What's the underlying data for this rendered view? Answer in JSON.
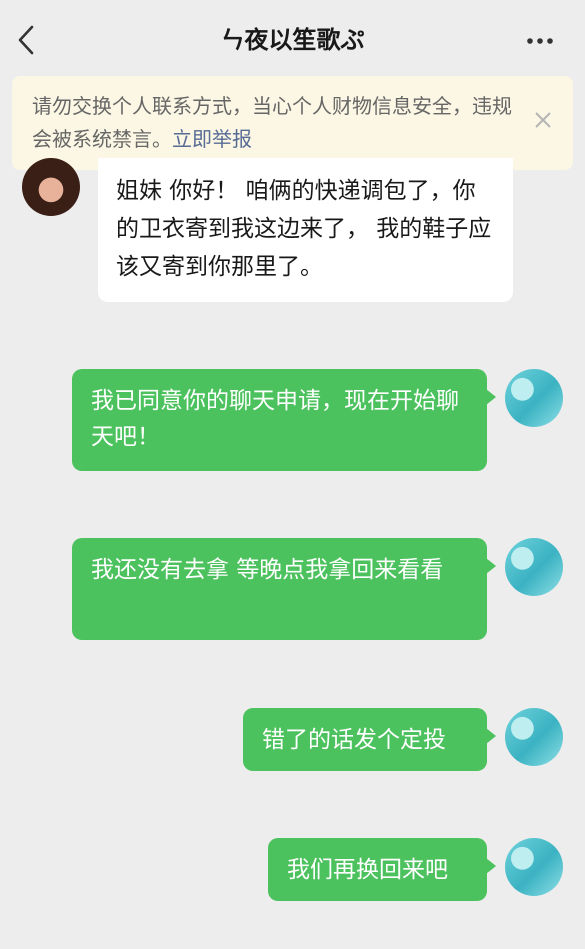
{
  "header": {
    "title": "ㄣ夜以笙歌ぷ",
    "back_icon": "chevron-left-icon",
    "more_icon": "more-horizontal-icon"
  },
  "warning": {
    "text": "请勿交换个人联系方式，当心个人财物信息安全，违规会被系统禁言。",
    "link": "立即举报",
    "close_icon": "close-icon"
  },
  "messages": [
    {
      "direction": "incoming",
      "text": "姐妹 你好！ 咱俩的快递调包了，你的卫衣寄到我这边来了， 我的鞋子应该又寄到你那里了。"
    },
    {
      "direction": "outgoing",
      "text": "我已同意你的聊天申请，现在开始聊天吧！"
    },
    {
      "direction": "outgoing",
      "text": "我还没有去拿 等晚点我拿回来看看"
    },
    {
      "direction": "outgoing",
      "text": "错了的话发个定投"
    },
    {
      "direction": "outgoing",
      "text": "我们再换回来吧"
    }
  ],
  "colors": {
    "background": "#ededed",
    "outgoing_bubble": "#4cc25e",
    "incoming_bubble": "#ffffff",
    "warning_background": "#fbf7e4",
    "link": "#576b95"
  }
}
